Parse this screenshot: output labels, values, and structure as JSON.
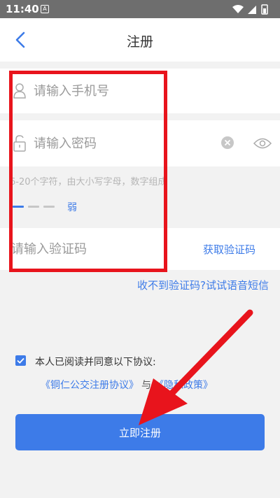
{
  "status_bar": {
    "time": "11:40",
    "notif_letter": "A"
  },
  "header": {
    "title": "注册"
  },
  "form": {
    "phone_placeholder": "请输入手机号",
    "password_placeholder": "请输入密码",
    "password_hint": "6-20个字符，由大小写字母，数字组成",
    "strength_label": "弱",
    "strength_level": 1,
    "code_placeholder": "请输入验证码",
    "get_code_label": "获取验证码",
    "voice_code_link": "收不到验证码?试试语音短信"
  },
  "agreement": {
    "checked": true,
    "text": "本人已阅读并同意以下协议:",
    "doc1": "《铜仁公交注册协议》",
    "separator": "与",
    "doc2": "《隐私政策》"
  },
  "register_button": "立即注册",
  "colors": {
    "accent": "#3d7be8",
    "annotation": "#e8141c"
  }
}
